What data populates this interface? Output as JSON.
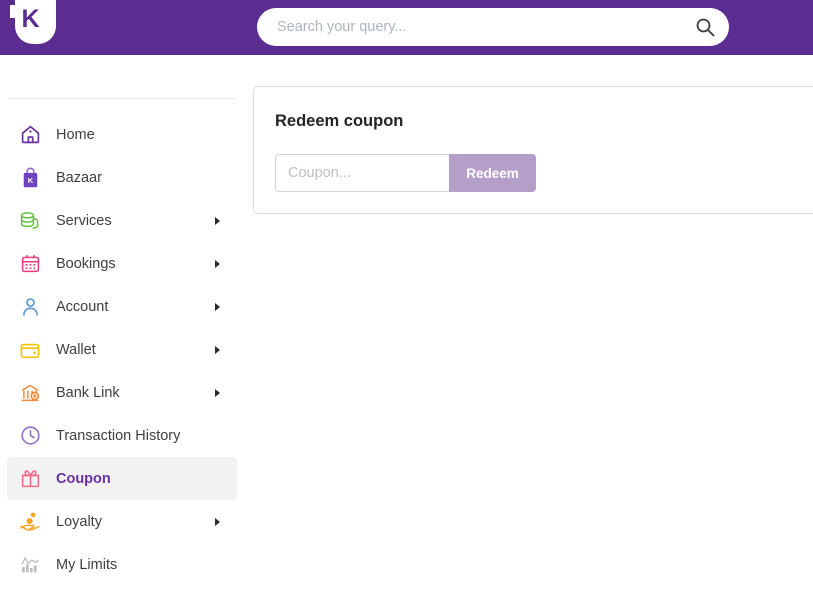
{
  "brand": {
    "logo_letter": "K",
    "logo_icon": "shield-logo",
    "header_color": "#5c2d91"
  },
  "search": {
    "placeholder": "Search your query...",
    "value": "",
    "icon": "search-icon"
  },
  "sidebar": {
    "items": [
      {
        "label": "Home",
        "icon": "home-icon",
        "icon_color": "#6a2fa0",
        "has_caret": false,
        "active": false
      },
      {
        "label": "Bazaar",
        "icon": "shopping-bag-icon",
        "icon_color": "#6f42c1",
        "has_caret": false,
        "active": false
      },
      {
        "label": "Services",
        "icon": "coins-stack-icon",
        "icon_color": "#5cc23a",
        "has_caret": true,
        "active": false
      },
      {
        "label": "Bookings",
        "icon": "calendar-icon",
        "icon_color": "#ea3c7d",
        "has_caret": true,
        "active": false
      },
      {
        "label": "Account",
        "icon": "user-icon",
        "icon_color": "#5b9bd5",
        "has_caret": true,
        "active": false
      },
      {
        "label": "Wallet",
        "icon": "wallet-icon",
        "icon_color": "#f2c400",
        "has_caret": true,
        "active": false
      },
      {
        "label": "Bank Link",
        "icon": "bank-icon",
        "icon_color": "#ef8a3c",
        "has_caret": true,
        "active": false
      },
      {
        "label": "Transaction History",
        "icon": "clock-icon",
        "icon_color": "#8e6fc4",
        "has_caret": false,
        "active": false
      },
      {
        "label": "Coupon",
        "icon": "gift-icon",
        "icon_color": "#f06a8a",
        "has_caret": false,
        "active": true
      },
      {
        "label": "Loyalty",
        "icon": "hand-loyalty-icon",
        "icon_color": "#fba120",
        "has_caret": true,
        "active": false
      },
      {
        "label": "My Limits",
        "icon": "bar-chart-icon",
        "icon_color": "#bdbdbd",
        "has_caret": false,
        "active": false
      }
    ],
    "active_label_color": "#6a2fa0",
    "active_row_bg": "#f2f2f2"
  },
  "main": {
    "card": {
      "title": "Redeem coupon",
      "coupon_placeholder": "Coupon...",
      "coupon_value": "",
      "redeem_label": "Redeem",
      "redeem_color": "#b49fc9"
    }
  }
}
